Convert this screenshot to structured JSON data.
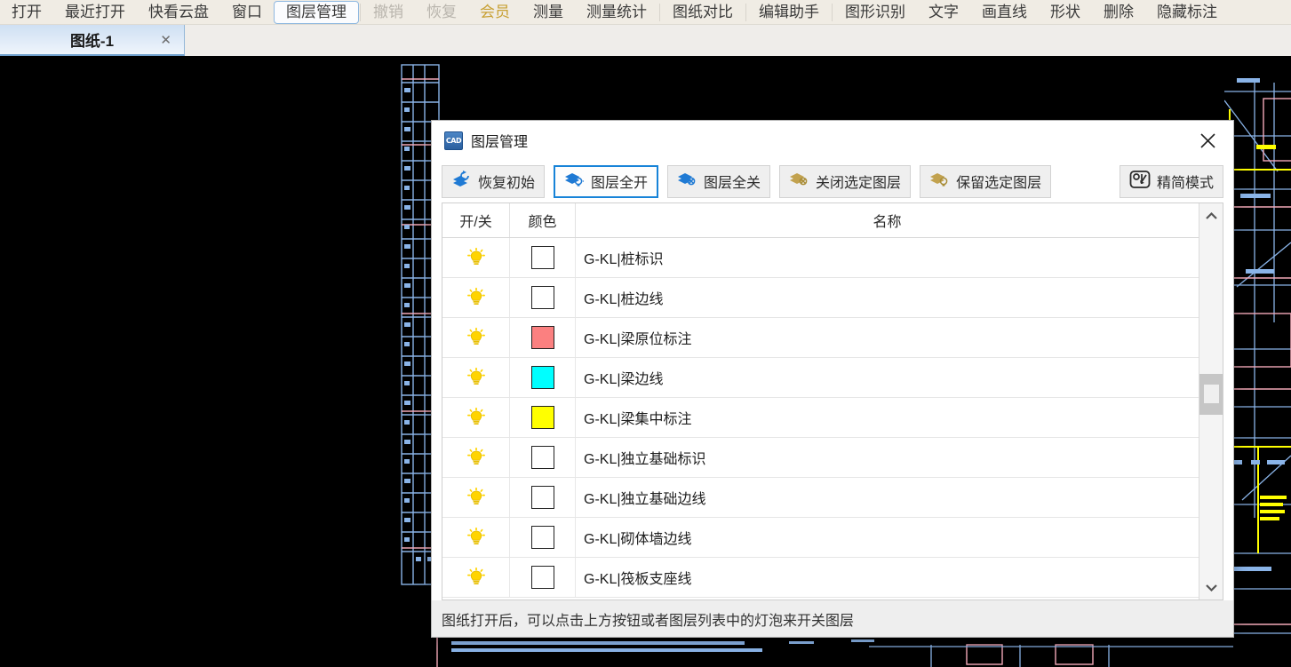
{
  "menubar": {
    "items": [
      {
        "label": "打开",
        "state": "normal"
      },
      {
        "label": "最近打开",
        "state": "normal"
      },
      {
        "label": "快看云盘",
        "state": "normal"
      },
      {
        "label": "窗口",
        "state": "normal"
      },
      {
        "label": "图层管理",
        "state": "active"
      },
      {
        "label": "撤销",
        "state": "dim"
      },
      {
        "label": "恢复",
        "state": "dim"
      },
      {
        "label": "会员",
        "state": "gold"
      },
      {
        "label": "测量",
        "state": "normal"
      },
      {
        "label": "测量统计",
        "state": "normal"
      },
      {
        "label": "图纸对比",
        "state": "normal"
      },
      {
        "label": "编辑助手",
        "state": "normal"
      },
      {
        "label": "图形识别",
        "state": "normal"
      },
      {
        "label": "文字",
        "state": "normal"
      },
      {
        "label": "画直线",
        "state": "normal"
      },
      {
        "label": "形状",
        "state": "normal"
      },
      {
        "label": "删除",
        "state": "normal"
      },
      {
        "label": "隐藏标注",
        "state": "normal"
      }
    ]
  },
  "tabs": [
    {
      "label": "图纸-1",
      "close_icon": "close-icon",
      "active": true
    }
  ],
  "dialog": {
    "icon": "cad-app-icon",
    "icon_text": "CAD",
    "title": "图层管理",
    "close_icon": "close-icon",
    "toolbar": [
      {
        "label": "恢复初始",
        "icon": "layers-restore-icon",
        "state": "enabled",
        "accent": "#1f7ad4"
      },
      {
        "label": "图层全开",
        "icon": "layers-bulb-on-icon",
        "state": "selected",
        "accent": "#1f7ad4"
      },
      {
        "label": "图层全关",
        "icon": "layers-bulb-off-icon",
        "state": "enabled",
        "accent": "#1f7ad4"
      },
      {
        "label": "关闭选定图层",
        "icon": "layers-close-selected-icon",
        "state": "disabled",
        "accent": "#b99a46"
      },
      {
        "label": "保留选定图层",
        "icon": "layers-keep-selected-icon",
        "state": "disabled",
        "accent": "#b99a46"
      },
      {
        "label": "精简模式",
        "icon": "simplify-mode-icon",
        "state": "enabled",
        "accent": "#2b2b2b"
      }
    ],
    "table": {
      "headers": [
        "开/关",
        "颜色",
        "名称"
      ],
      "rows": [
        {
          "on": true,
          "bulb_icon": "lightbulb-on-icon",
          "color": "#ffffff",
          "name": "G-KL|桩标识"
        },
        {
          "on": true,
          "bulb_icon": "lightbulb-on-icon",
          "color": "#ffffff",
          "name": "G-KL|桩边线"
        },
        {
          "on": true,
          "bulb_icon": "lightbulb-on-icon",
          "color": "#fb8080",
          "name": "G-KL|梁原位标注"
        },
        {
          "on": true,
          "bulb_icon": "lightbulb-on-icon",
          "color": "#00ffff",
          "name": "G-KL|梁边线"
        },
        {
          "on": true,
          "bulb_icon": "lightbulb-on-icon",
          "color": "#ffff00",
          "name": "G-KL|梁集中标注"
        },
        {
          "on": true,
          "bulb_icon": "lightbulb-on-icon",
          "color": "#ffffff",
          "name": "G-KL|独立基础标识"
        },
        {
          "on": true,
          "bulb_icon": "lightbulb-on-icon",
          "color": "#ffffff",
          "name": "G-KL|独立基础边线"
        },
        {
          "on": true,
          "bulb_icon": "lightbulb-on-icon",
          "color": "#ffffff",
          "name": "G-KL|砌体墙边线"
        },
        {
          "on": true,
          "bulb_icon": "lightbulb-on-icon",
          "color": "#ffffff",
          "name": "G-KL|筏板支座线"
        }
      ]
    },
    "scrollbar": {
      "up_icon": "chevron-up-icon",
      "down_icon": "chevron-down-icon",
      "thumb": "scrollbar-thumb"
    },
    "hint": "图纸打开后，可以点击上方按钮或者图层列表中的灯泡来开关图层"
  },
  "canvas": {
    "background": "#000000",
    "colors": {
      "blue": "#8ab4e8",
      "pink": "#f3a9b8",
      "yellow": "#ffff00",
      "white": "#ffffff"
    }
  }
}
